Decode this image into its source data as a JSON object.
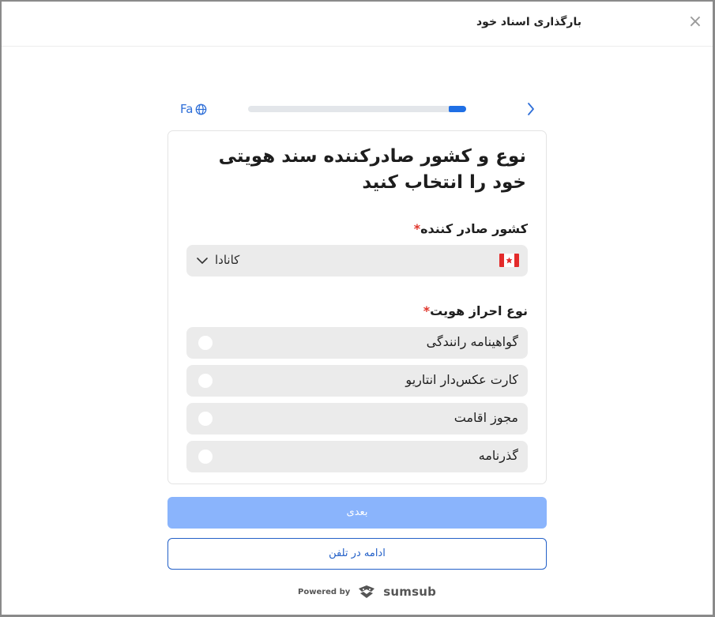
{
  "header": {
    "title": "بارگذاری اسناد خود",
    "close_symbol": "×"
  },
  "topbar": {
    "language": "Fa",
    "progress_fraction": 0.08
  },
  "form": {
    "title": "نوع و کشور صادرکننده سند هویتی خود را انتخاب کنید",
    "country_label": "کشور صادر کننده",
    "required_mark": "*",
    "country_value": "کانادا",
    "doc_type_label": "نوع احراز هویت",
    "doc_options": [
      {
        "label": "گواهینامه رانندگی"
      },
      {
        "label": "کارت عکس‌دار انتاریو"
      },
      {
        "label": "مجوز اقامت"
      },
      {
        "label": "گذرنامه"
      }
    ]
  },
  "actions": {
    "next_label": "بعدی",
    "phone_label": "ادامه در تلفن"
  },
  "footer": {
    "powered_by": "Powered by",
    "brand": "sumsub"
  },
  "colors": {
    "accent": "#1f6fe5",
    "disabled_button": "#8ab4fc",
    "required": "#e0352b",
    "option_bg": "#ebebeb"
  }
}
